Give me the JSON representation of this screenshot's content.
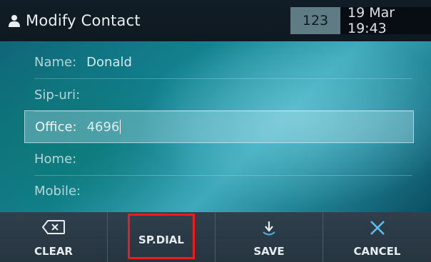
{
  "header": {
    "title": "Modify Contact",
    "title_icon": "person-icon",
    "input_mode": "123",
    "datetime": "19 Mar 19:43"
  },
  "form": {
    "fields": [
      {
        "label": "Name:",
        "value": "Donald"
      },
      {
        "label": "Sip-uri:",
        "value": ""
      },
      {
        "label": "Office:",
        "value": "4696"
      },
      {
        "label": "Home:",
        "value": ""
      },
      {
        "label": "Mobile:",
        "value": ""
      }
    ],
    "active_field_index": 2
  },
  "softkeys": [
    {
      "label": "CLEAR",
      "icon": "backspace-icon"
    },
    {
      "label": "SP.DIAL",
      "icon": "",
      "highlighted": true
    },
    {
      "label": "SAVE",
      "icon": "save-arrow-icon"
    },
    {
      "label": "CANCEL",
      "icon": "close-icon"
    }
  ],
  "colors": {
    "highlight_border": "#ee1c1c",
    "titlebar_bg": "#111d26",
    "softkey_bg": "#2f3f4b"
  }
}
